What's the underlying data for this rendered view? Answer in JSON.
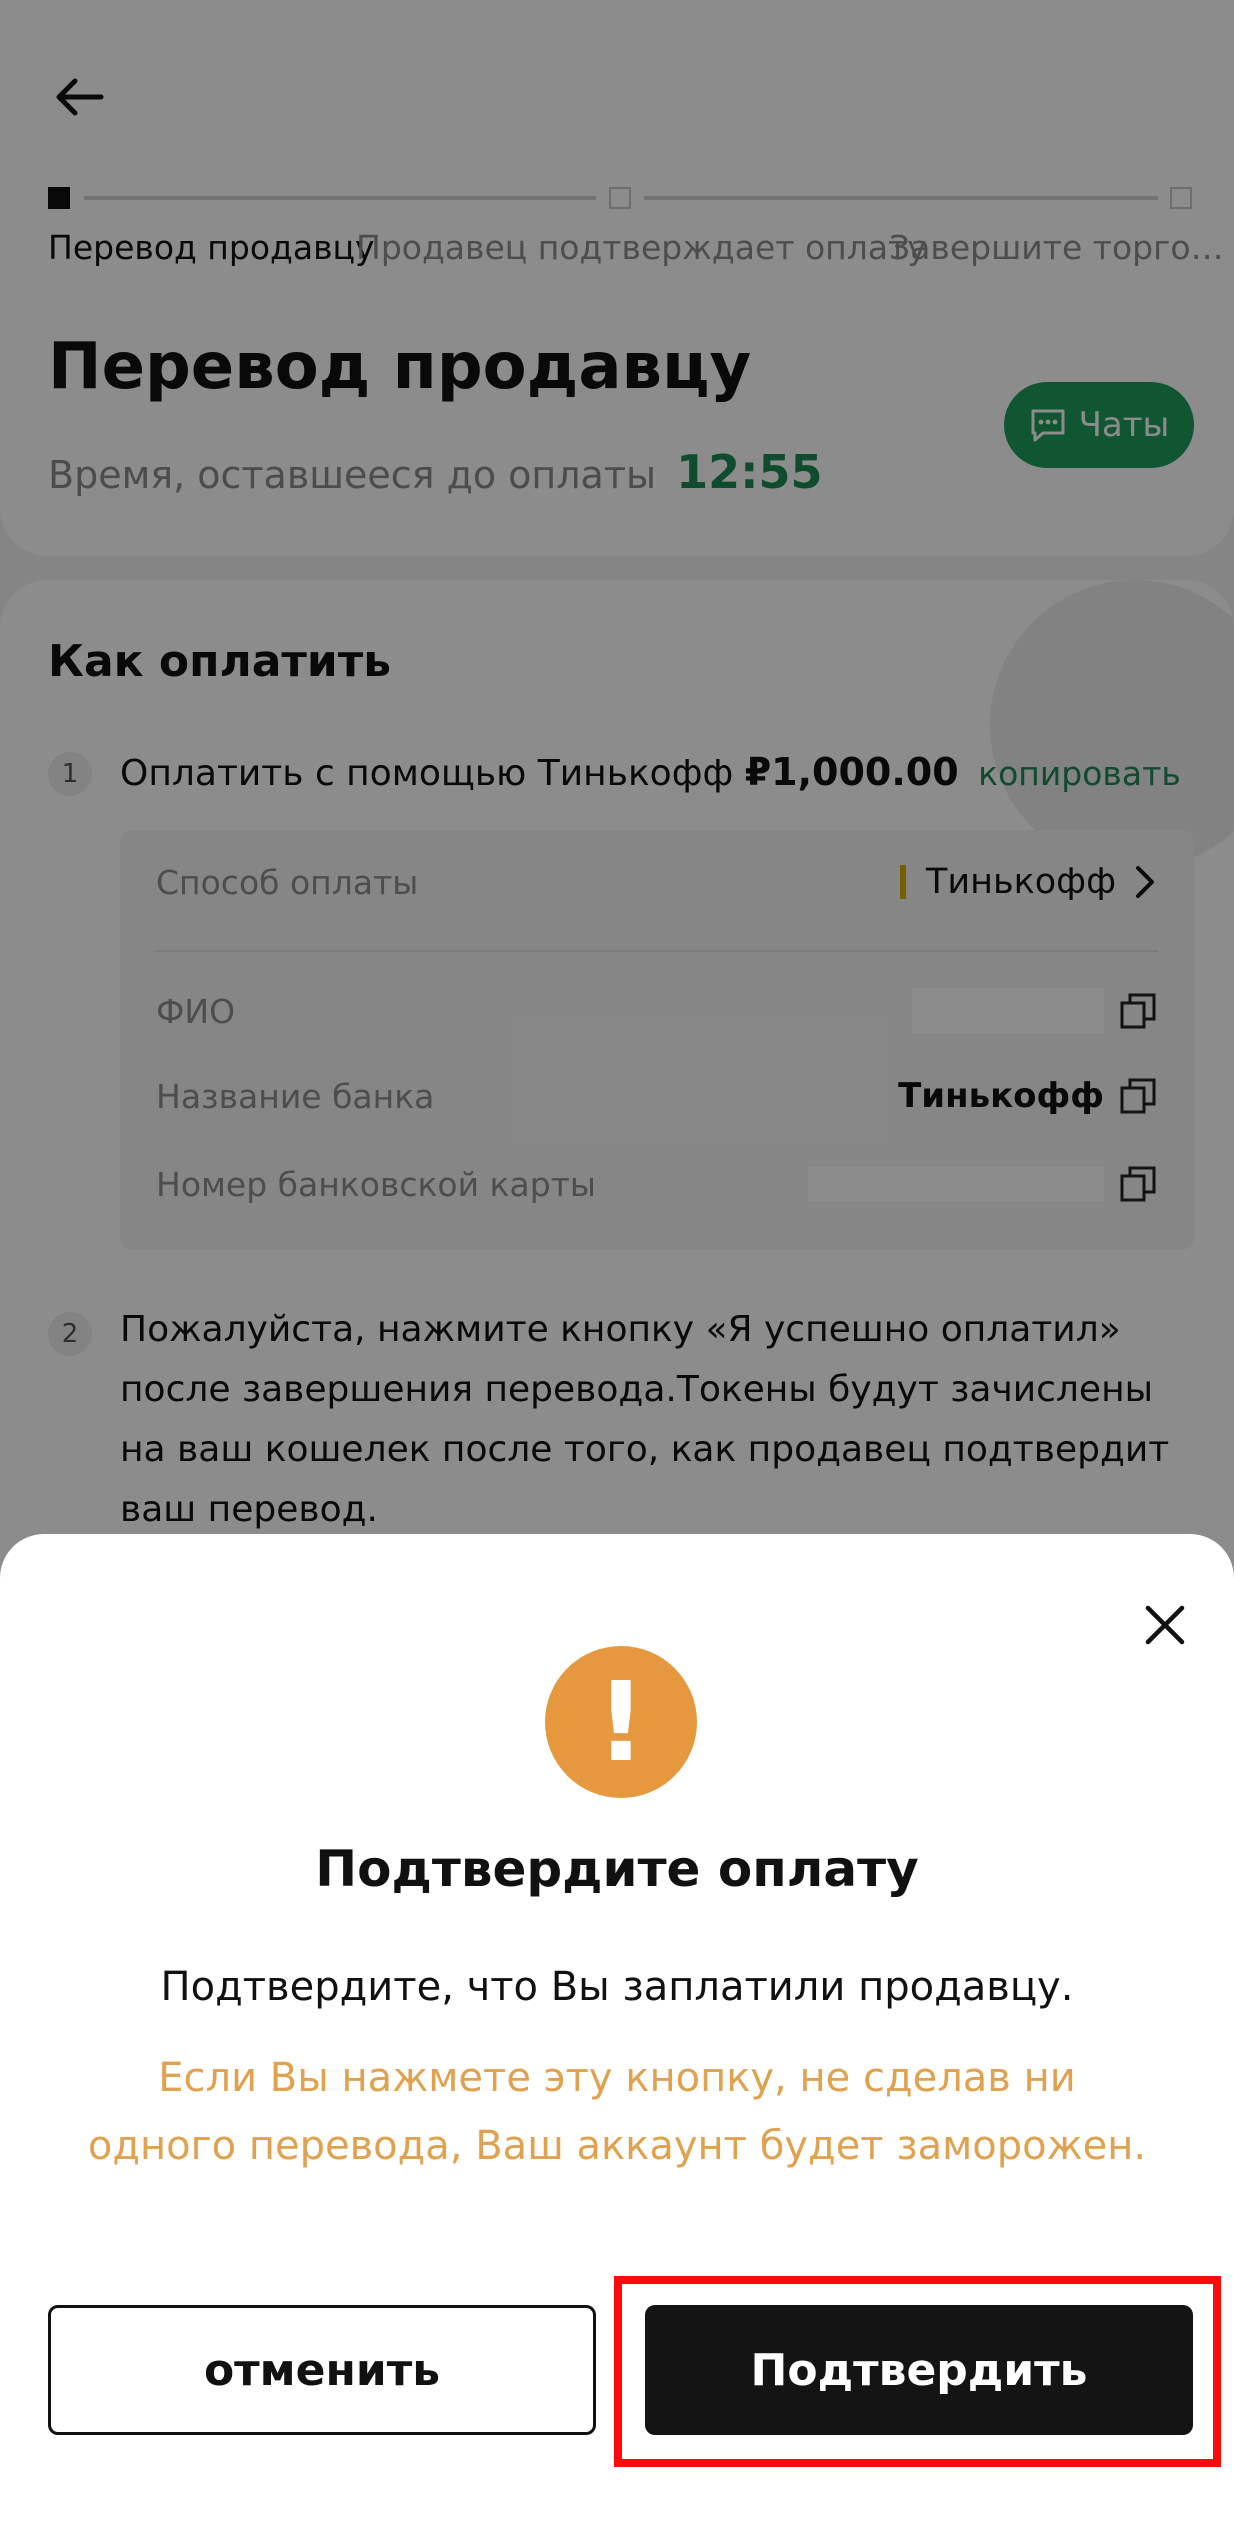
{
  "stepper": {
    "steps": [
      {
        "label": "Перевод продавцу"
      },
      {
        "label": "Продавец подтверждает оплату"
      },
      {
        "label": "Завершите торго…"
      }
    ]
  },
  "header": {
    "title": "Перевод продавцу",
    "timer_label": "Время, оставшееся до оплаты",
    "timer_value": "12:55",
    "chat_label": "Чаты"
  },
  "how_to_pay": {
    "title": "Как оплатить",
    "step1_num": "1",
    "step1_text": "Оплатить с помощью Тинькофф",
    "amount": "₽1,000.00",
    "copy_label": "копировать",
    "details": {
      "method_label": "Способ оплаты",
      "method_value": "Тинькофф",
      "name_label": "ФИО",
      "bank_label": "Название банка",
      "bank_value": "Тинькофф",
      "card_label": "Номер банковской карты"
    },
    "step2_num": "2",
    "step2_text": "Пожалуйста, нажмите кнопку «Я успешно оплатил» после завершения перевода.Токены будут зачислены на ваш кошелек после того, как продавец подтвердит ваш перевод."
  },
  "modal": {
    "icon": "exclamation-icon",
    "icon_glyph": "!",
    "title": "Подтвердите оплату",
    "message": "Подтвердите, что Вы заплатили продавцу.",
    "warning": "Если Вы нажмете эту кнопку, не сделав ни одного перевода, Ваш аккаунт будет заморожен.",
    "cancel_label": "отменить",
    "confirm_label": "Подтвердить"
  },
  "colors": {
    "accent_green": "#1d8a55",
    "warning_orange": "#e6983f",
    "highlight_red": "#ff0a0a"
  }
}
